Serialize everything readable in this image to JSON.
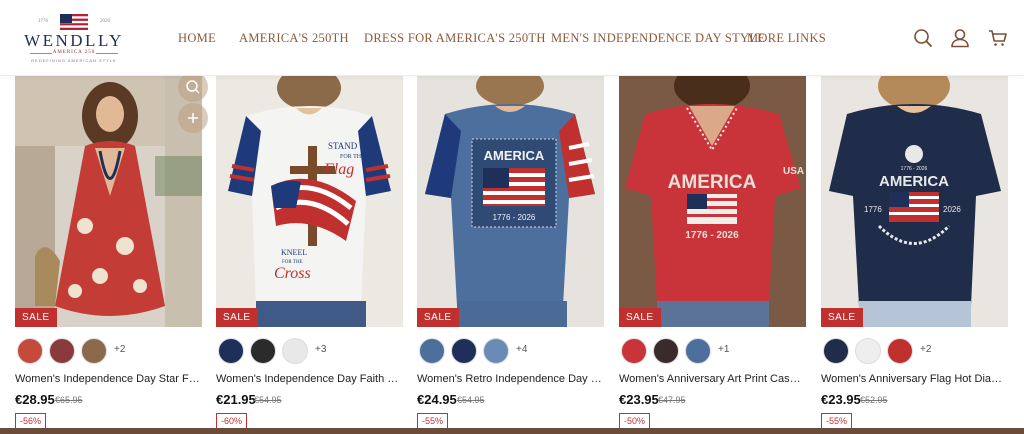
{
  "brand": {
    "name": "WENDLLY",
    "year_left": "1776",
    "year_right": "2026",
    "subtitle": "AMERICA 250",
    "tagline": "REDEFINING AMERICAN STYLE"
  },
  "nav": {
    "items": [
      {
        "label": "HOME"
      },
      {
        "label": "AMERICA'S 250TH"
      },
      {
        "label": "DRESS FOR AMERICA'S 250TH"
      },
      {
        "label": "MEN'S INDEPENDENCE DAY STYLE"
      },
      {
        "label": "MORE LINKS"
      }
    ]
  },
  "header_icons": [
    "search-icon",
    "account-icon",
    "cart-icon"
  ],
  "colors": {
    "nav_text": "#8a5a3a",
    "sale_badge": "#c0302f",
    "brand_navy": "#1e2f5a"
  },
  "products": [
    {
      "badge": "SALE",
      "swatches_more": "+2",
      "title": "Women's Independence Day Star Flow...",
      "price": "€28.95",
      "old_price": "€65.95",
      "discount": "-56%"
    },
    {
      "badge": "SALE",
      "swatches_more": "+3",
      "title": "Women's Independence Day Faith Flag ...",
      "price": "€21.95",
      "old_price": "€54.95",
      "discount": "-60%"
    },
    {
      "badge": "SALE",
      "swatches_more": "+4",
      "title": "Women's Retro Independence Day Flag...",
      "price": "€24.95",
      "old_price": "€54.95",
      "discount": "-55%"
    },
    {
      "badge": "SALE",
      "swatches_more": "+1",
      "title": "Women's Anniversary Art Print Casual ...",
      "price": "€23.95",
      "old_price": "€47.95",
      "discount": "-50%"
    },
    {
      "badge": "SALE",
      "swatches_more": "+2",
      "title": "Women's Anniversary Flag Hot Diamon...",
      "price": "€23.95",
      "old_price": "€52.95",
      "discount": "-55%"
    }
  ],
  "product_art": {
    "card2": {
      "line1": "STAND",
      "line2": "FOR THE",
      "line3": "Flag",
      "line4": "KNEEL",
      "line5": "FOR THE",
      "line6": "Cross"
    },
    "card3": {
      "headline": "AMERICA",
      "years": "1776 - 2026"
    },
    "card4": {
      "headline": "AMERICA",
      "years": "1776 - 2026",
      "sleeve": "USA"
    },
    "card5": {
      "headline": "AMERICA",
      "year_left": "1776",
      "year_right": "2026",
      "ribbon": "1776 - 2026"
    }
  }
}
